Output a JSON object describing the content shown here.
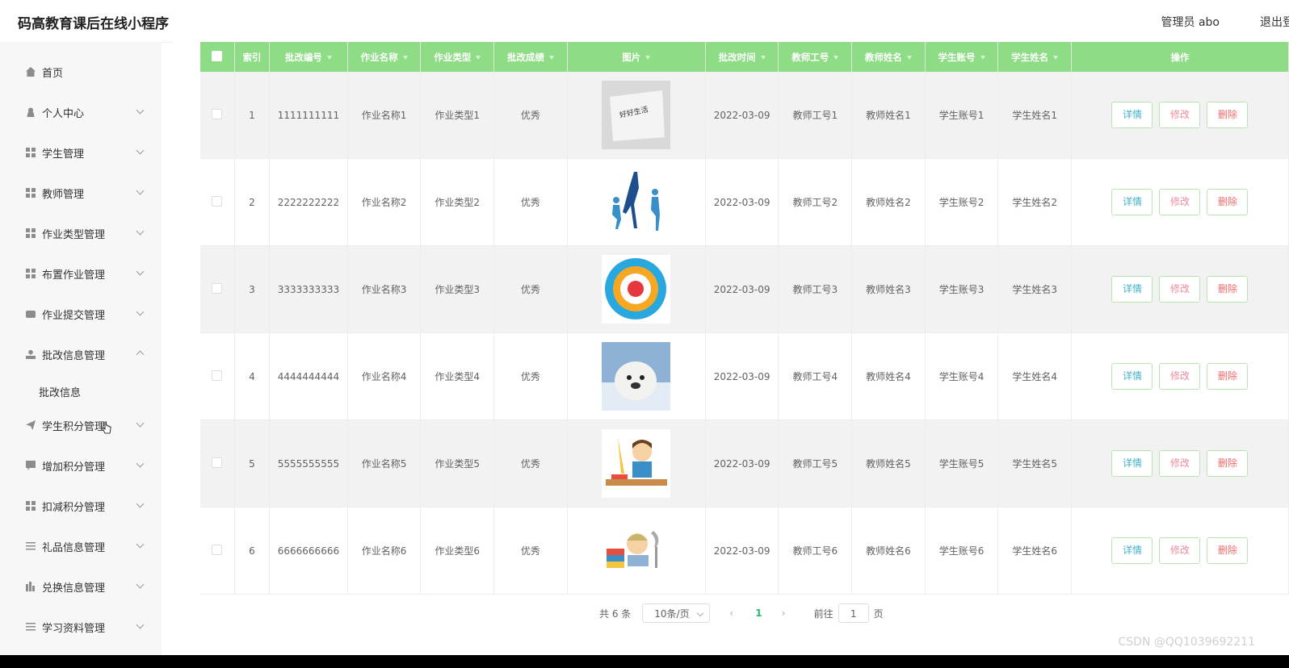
{
  "app": {
    "title": "码高教育课后在线小程序",
    "admin_label": "管理员 abo",
    "logout_label": "退出登"
  },
  "sidebar": {
    "items": [
      {
        "label": "首页",
        "icon": "home-icon"
      },
      {
        "label": "个人中心",
        "icon": "user-icon"
      },
      {
        "label": "学生管理",
        "icon": "grid-icon"
      },
      {
        "label": "教师管理",
        "icon": "grid-icon"
      },
      {
        "label": "作业类型管理",
        "icon": "grid-icon"
      },
      {
        "label": "布置作业管理",
        "icon": "grid-icon"
      },
      {
        "label": "作业提交管理",
        "icon": "print-icon"
      },
      {
        "label": "批改信息管理",
        "icon": "person-icon"
      },
      {
        "label": "学生积分管理",
        "icon": "send-icon"
      },
      {
        "label": "增加积分管理",
        "icon": "chat-icon"
      },
      {
        "label": "扣减积分管理",
        "icon": "grid-icon"
      },
      {
        "label": "礼品信息管理",
        "icon": "sliders-icon"
      },
      {
        "label": "兑换信息管理",
        "icon": "bars-icon"
      },
      {
        "label": "学习资料管理",
        "icon": "list-icon"
      }
    ],
    "sub_item": "批改信息"
  },
  "table": {
    "headers": [
      "索引",
      "批改编号",
      "作业名称",
      "作业类型",
      "批改成绩",
      "图片",
      "批改时间",
      "教师工号",
      "教师姓名",
      "学生账号",
      "学生姓名",
      "操作"
    ],
    "rows": [
      {
        "index": "1",
        "code": "1111111111",
        "name": "作业名称1",
        "type": "作业类型1",
        "grade": "优秀",
        "image": "paper-note-image",
        "image_text": "好好生活",
        "time": "2022-03-09",
        "teacher_no": "教师工号1",
        "teacher_name": "教师姓名1",
        "student_no": "学生账号1",
        "student_name": "学生姓名1"
      },
      {
        "index": "2",
        "code": "2222222222",
        "name": "作业名称2",
        "type": "作业类型2",
        "grade": "优秀",
        "image": "sports-silhouettes-image",
        "time": "2022-03-09",
        "teacher_no": "教师工号2",
        "teacher_name": "教师姓名2",
        "student_no": "学生账号2",
        "student_name": "学生姓名2"
      },
      {
        "index": "3",
        "code": "3333333333",
        "name": "作业名称3",
        "type": "作业类型3",
        "grade": "优秀",
        "image": "circle-diagram-image",
        "time": "2022-03-09",
        "teacher_no": "教师工号3",
        "teacher_name": "教师姓名3",
        "student_no": "学生账号3",
        "student_name": "学生姓名3"
      },
      {
        "index": "4",
        "code": "4444444444",
        "name": "作业名称4",
        "type": "作业类型4",
        "grade": "优秀",
        "image": "seal-photo-image",
        "time": "2022-03-09",
        "teacher_no": "教师工号4",
        "teacher_name": "教师姓名4",
        "student_no": "学生账号4",
        "student_name": "学生姓名4"
      },
      {
        "index": "5",
        "code": "5555555555",
        "name": "作业名称5",
        "type": "作业类型5",
        "grade": "优秀",
        "image": "boy-studying-image",
        "time": "2022-03-09",
        "teacher_no": "教师工号5",
        "teacher_name": "教师姓名5",
        "student_no": "学生账号5",
        "student_name": "学生姓名5"
      },
      {
        "index": "6",
        "code": "6666666666",
        "name": "作业名称6",
        "type": "作业类型6",
        "grade": "优秀",
        "image": "child-reading-image",
        "time": "2022-03-09",
        "teacher_no": "教师工号6",
        "teacher_name": "教师姓名6",
        "student_no": "学生账号6",
        "student_name": "学生姓名6"
      }
    ],
    "actions": {
      "detail": "详情",
      "edit": "修改",
      "delete": "删除"
    }
  },
  "pagination": {
    "total_label": "共 6 条",
    "page_size": "10条/页",
    "current_page": "1",
    "goto_label": "前往",
    "goto_value": "1",
    "page_suffix": "页"
  },
  "watermark": "CSDN @QQ1039692211",
  "colors": {
    "header_green": "#8edc86",
    "detail": "#41b0c8",
    "edit": "#f08c9c",
    "delete": "#f06a6a",
    "current_page": "#2bb673"
  }
}
